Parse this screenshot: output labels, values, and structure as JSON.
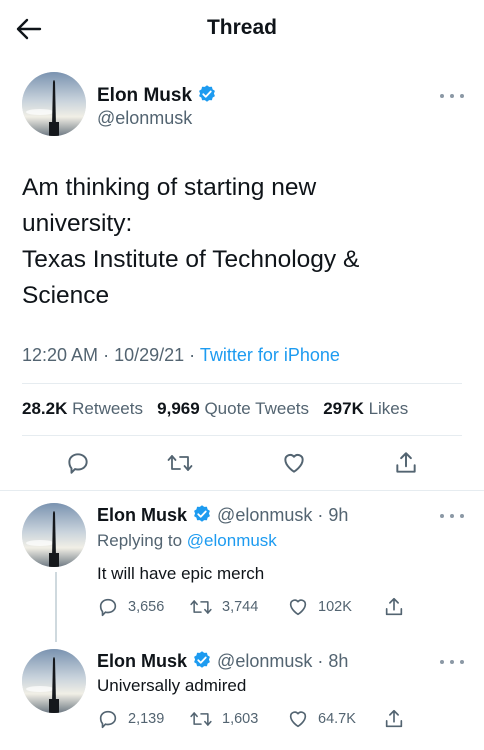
{
  "header": {
    "title": "Thread"
  },
  "tweet": {
    "author_name": "Elon Musk",
    "author_handle": "@elonmusk",
    "text": "Am thinking of starting new\nuniversity:\nTexas Institute of Technology &\nScience",
    "time": "12:20 AM",
    "date": "10/29/21",
    "source": "Twitter for iPhone",
    "retweets_count": "28.2K",
    "retweets_label": "Retweets",
    "quote_count": "9,969",
    "quote_label": "Quote Tweets",
    "likes_count": "297K",
    "likes_label": "Likes"
  },
  "replies": [
    {
      "author_name": "Elon Musk",
      "author_handle": "@elonmusk",
      "age": "9h",
      "replying_prefix": "Replying to",
      "replying_to": "@elonmusk",
      "text": "It will have epic merch",
      "reply_count": "3,656",
      "retweet_count": "3,744",
      "like_count": "102K"
    },
    {
      "author_name": "Elon Musk",
      "author_handle": "@elonmusk",
      "age": "8h",
      "text": "Universally admired",
      "reply_count": "2,139",
      "retweet_count": "1,603",
      "like_count": "64.7K"
    }
  ],
  "colors": {
    "accent": "#1d9bf0",
    "muted": "#536471",
    "text": "#0f1419"
  },
  "icons": [
    "back-arrow-icon",
    "verified-icon",
    "more-icon",
    "reply-icon",
    "retweet-icon",
    "like-icon",
    "share-icon"
  ]
}
